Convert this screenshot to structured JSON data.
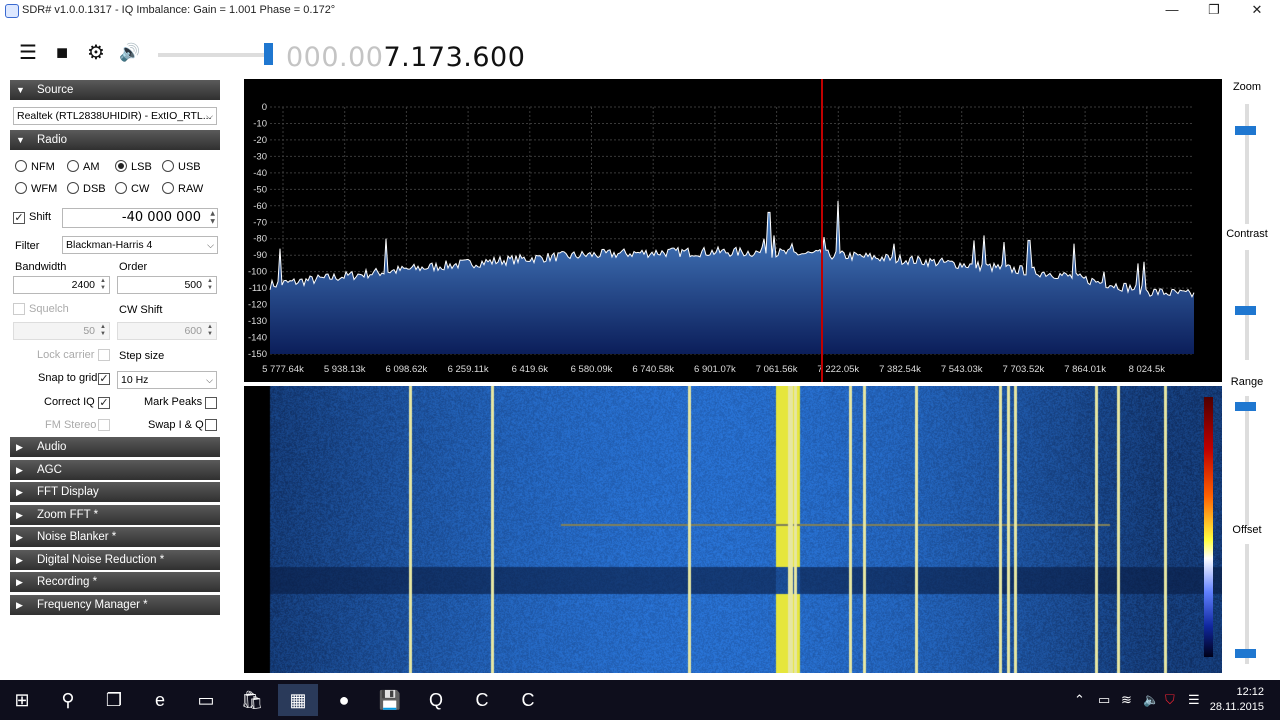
{
  "window": {
    "title": "SDR# v1.0.0.1317 - IQ Imbalance: Gain = 1.001 Phase = 0.172°",
    "minimize": "—",
    "maximize": "❐",
    "close": "✕"
  },
  "toolbar": {
    "menu_icon": "☰",
    "stop_icon": "■",
    "settings_icon": "⚙",
    "volume_icon": "🔊",
    "volume_level_fraction": 0.95,
    "frequency_dim": "000.00",
    "frequency_active": "7.173.600"
  },
  "source": {
    "header": "Source",
    "device": "Realtek (RTL2838UHIDIR) - ExtIO_RTL..."
  },
  "radio": {
    "header": "Radio",
    "modes": [
      {
        "label": "NFM",
        "selected": false
      },
      {
        "label": "AM",
        "selected": false
      },
      {
        "label": "LSB",
        "selected": true
      },
      {
        "label": "USB",
        "selected": false
      },
      {
        "label": "WFM",
        "selected": false
      },
      {
        "label": "DSB",
        "selected": false
      },
      {
        "label": "CW",
        "selected": false
      },
      {
        "label": "RAW",
        "selected": false
      }
    ],
    "shift_label": "Shift",
    "shift_checked": true,
    "shift_value": "-40 000 000",
    "filter_label": "Filter",
    "filter_value": "Blackman-Harris 4",
    "bandwidth_label": "Bandwidth",
    "bandwidth_value": "2400",
    "order_label": "Order",
    "order_value": "500",
    "squelch_label": "Squelch",
    "squelch_value": "50",
    "cw_shift_label": "CW Shift",
    "cw_shift_value": "600",
    "lock_carrier_label": "Lock carrier",
    "step_size_label": "Step size",
    "snap_label": "Snap to grid",
    "snap_value": "10 Hz",
    "correct_iq_label": "Correct IQ",
    "mark_peaks_label": "Mark Peaks",
    "fm_stereo_label": "FM Stereo",
    "swap_iq_label": "Swap I & Q",
    "checked_mark": "✓"
  },
  "sections": [
    "Audio",
    "AGC",
    "FFT Display",
    "Zoom FFT *",
    "Noise Blanker *",
    "Digital Noise Reduction *",
    "Recording *",
    "Frequency Manager *"
  ],
  "spectrum": {
    "y_ticks": [
      "0",
      "-10",
      "-20",
      "-30",
      "-40",
      "-50",
      "-60",
      "-70",
      "-80",
      "-90",
      "-100",
      "-110",
      "-120",
      "-130",
      "-140",
      "-150"
    ],
    "x_ticks": [
      "5 777.64k",
      "5 938.13k",
      "6 098.62k",
      "6 259.11k",
      "6 419.6k",
      "6 580.09k",
      "6 740.58k",
      "6 901.07k",
      "7 061.56k",
      "7 222.05k",
      "7 382.54k",
      "7 543.03k",
      "7 703.52k",
      "7 864.01k",
      "8 024.5k"
    ],
    "colors": {
      "grid": "#3a3a3a",
      "trace": "#ffffff",
      "fill_top": "#4f8ad0",
      "fill_bottom": "#0b1e5a",
      "tuner": "#c00000"
    }
  },
  "right": {
    "zoom_label": "Zoom",
    "contrast_label": "Contrast",
    "range_label": "Range",
    "offset_label": "Offset",
    "zoom_level": 0.2,
    "contrast_level": 0.55,
    "range_level": 0.95,
    "offset_level": 0.05
  },
  "taskbar": {
    "apps": [
      {
        "name": "start-windows-icon",
        "glyph": "⊞"
      },
      {
        "name": "search-icon",
        "glyph": "⚲"
      },
      {
        "name": "task-view-icon",
        "glyph": "❐"
      },
      {
        "name": "edge-icon",
        "glyph": "e"
      },
      {
        "name": "file-explorer-icon",
        "glyph": "▭"
      },
      {
        "name": "store-icon",
        "glyph": "🛍"
      },
      {
        "name": "sdrsharp-icon",
        "glyph": "▦"
      },
      {
        "name": "firefox-icon",
        "glyph": "●"
      },
      {
        "name": "save-icon",
        "glyph": "💾"
      },
      {
        "name": "app-q-icon",
        "glyph": "Q"
      },
      {
        "name": "app-c-icon",
        "glyph": "C"
      },
      {
        "name": "app-c2-icon",
        "glyph": "C"
      }
    ],
    "time": "12:12",
    "date": "28.11.2015"
  }
}
